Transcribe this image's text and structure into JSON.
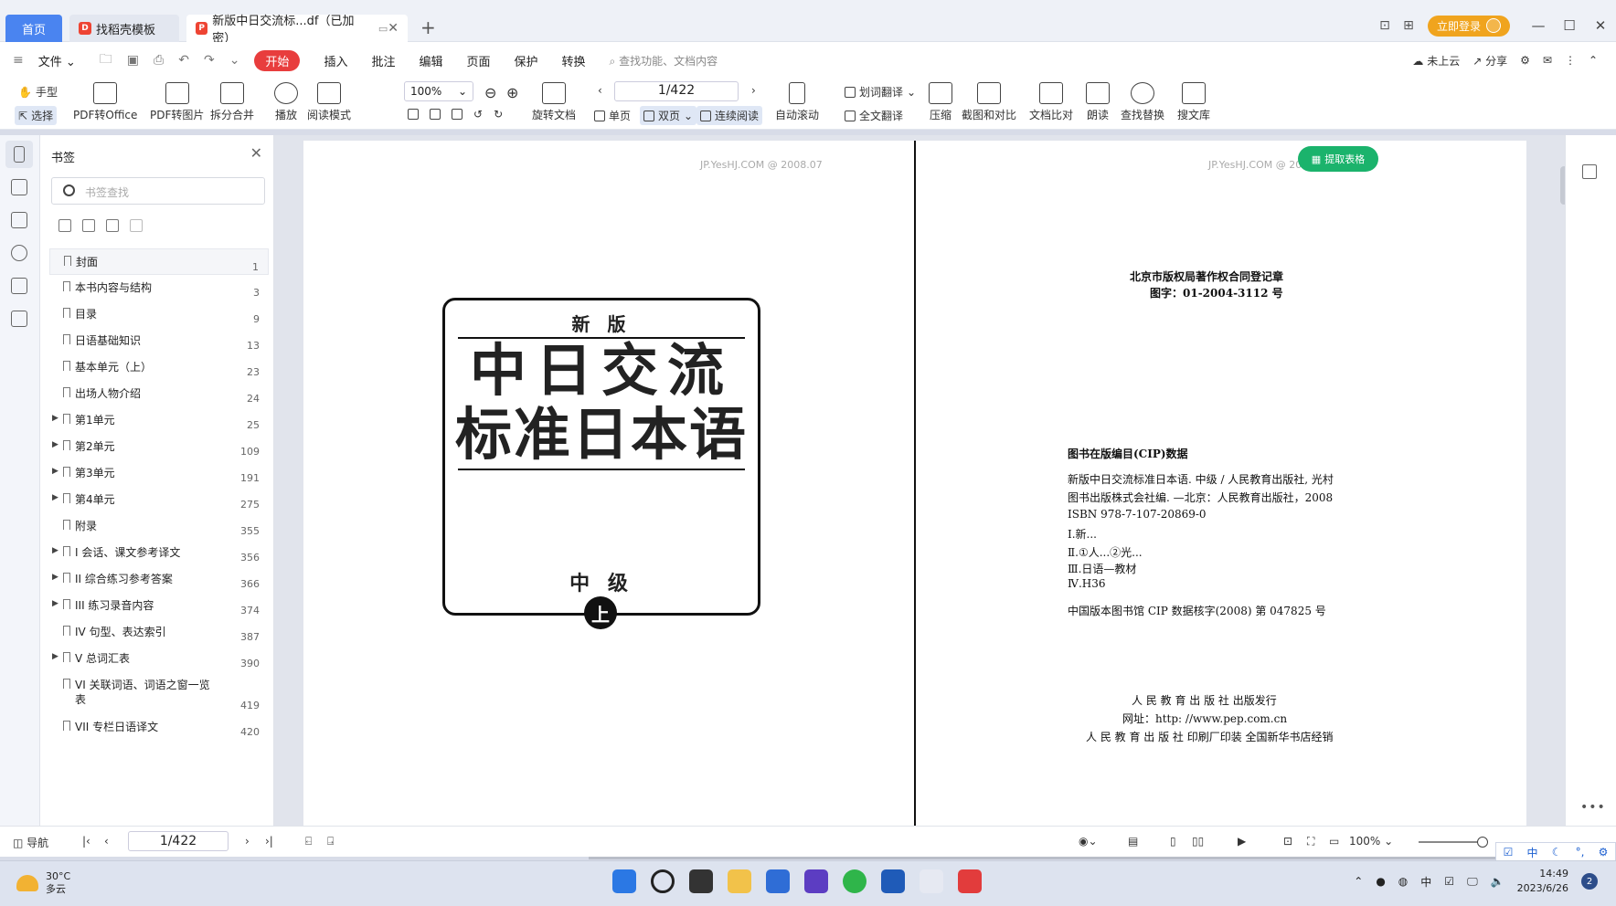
{
  "tabs": {
    "home": "首页",
    "template": "找稻壳模板",
    "document": "新版中日交流标...df（已加密）"
  },
  "window": {
    "login": "立即登录"
  },
  "menu": {
    "file": "文件",
    "items": [
      "开始",
      "插入",
      "批注",
      "编辑",
      "页面",
      "保护",
      "转换"
    ],
    "search_placeholder": "查找功能、文档内容",
    "cloud": "未上云",
    "share": "分享"
  },
  "toolbar": {
    "hand": "手型",
    "select": "选择",
    "pdf_to_office": "PDF转Office",
    "pdf_to_image": "PDF转图片",
    "split_merge": "拆分合并",
    "play": "播放",
    "read_mode": "阅读模式",
    "zoom": "100%",
    "rotate": "旋转文档",
    "page_indicator": "1/422",
    "single": "单页",
    "double": "双页",
    "continuous": "连续阅读",
    "auto_scroll": "自动滚动",
    "word_translate": "划词翻译",
    "full_translate": "全文翻译",
    "compress": "压缩",
    "screenshot_compare": "截图和对比",
    "doc_compare": "文档比对",
    "read_aloud": "朗读",
    "find_replace": "查找替换",
    "library": "搜文库"
  },
  "bookmarks": {
    "title": "书签",
    "search_placeholder": "书签查找",
    "items": [
      {
        "label": "封面",
        "page": "1"
      },
      {
        "label": "本书内容与结构",
        "page": "3"
      },
      {
        "label": "目录",
        "page": "9"
      },
      {
        "label": "日语基础知识",
        "page": "13"
      },
      {
        "label": "基本单元（上）",
        "page": "23"
      },
      {
        "label": "出场人物介绍",
        "page": "24"
      },
      {
        "label": "第1单元",
        "page": "25"
      },
      {
        "label": "第2单元",
        "page": "109"
      },
      {
        "label": "第3单元",
        "page": "191"
      },
      {
        "label": "第4单元",
        "page": "275"
      },
      {
        "label": "附录",
        "page": "355"
      },
      {
        "label": "I 会话、课文参考译文",
        "page": "356"
      },
      {
        "label": "II 综合练习参考答案",
        "page": "366"
      },
      {
        "label": "III 练习录音内容",
        "page": "374"
      },
      {
        "label": "IV 句型、表达索引",
        "page": "387"
      },
      {
        "label": "V 总词汇表",
        "page": "390"
      },
      {
        "label": "VI 关联词语、词语之窗一览表",
        "page": "419"
      },
      {
        "label": "VII 专栏日语译文",
        "page": "420"
      }
    ]
  },
  "document": {
    "watermark_left": "JP.YesHJ.COM @ 2008.07",
    "watermark_right": "JP.YesHJ.COM @ 20",
    "extract_table": "提取表格",
    "cover": {
      "edition": "新 版",
      "title_line1": "中日交流",
      "title_line2": "标准日本语",
      "level": "中 级",
      "volume": "上"
    },
    "copyright": {
      "reg_line1": "北京市版权局著作权合同登记章",
      "reg_line2": "图字：01-2004-3112 号",
      "cip_title": "图书在版编目(CIP)数据",
      "cip_lines": [
        "新版中日交流标准日本语. 中级 / 人民教育出版社, 光村",
        "图书出版株式会社编. —北京：人民教育出版社，2008",
        "ISBN 978-7-107-20869-0",
        "Ⅰ.新...",
        "Ⅱ.①人...②光...",
        "Ⅲ.日语—教材",
        "Ⅳ.H36"
      ],
      "cip_number": "中国版本图书馆 CIP 数据核字(2008) 第 047825 号",
      "publisher": "人 民 教 育 出 版 社 出版发行",
      "website": "网址：http: //www.pep.com.cn",
      "printer": "人 民 教 育 出 版 社 印刷厂印装   全国新华书店经销"
    }
  },
  "status": {
    "nav": "导航",
    "page": "1/422",
    "zoom": "100%"
  },
  "taskbar": {
    "temp": "30°C",
    "weather": "多云",
    "time": "14:49",
    "date": "2023/6/26",
    "notif": "2",
    "ime_lang": "中"
  }
}
